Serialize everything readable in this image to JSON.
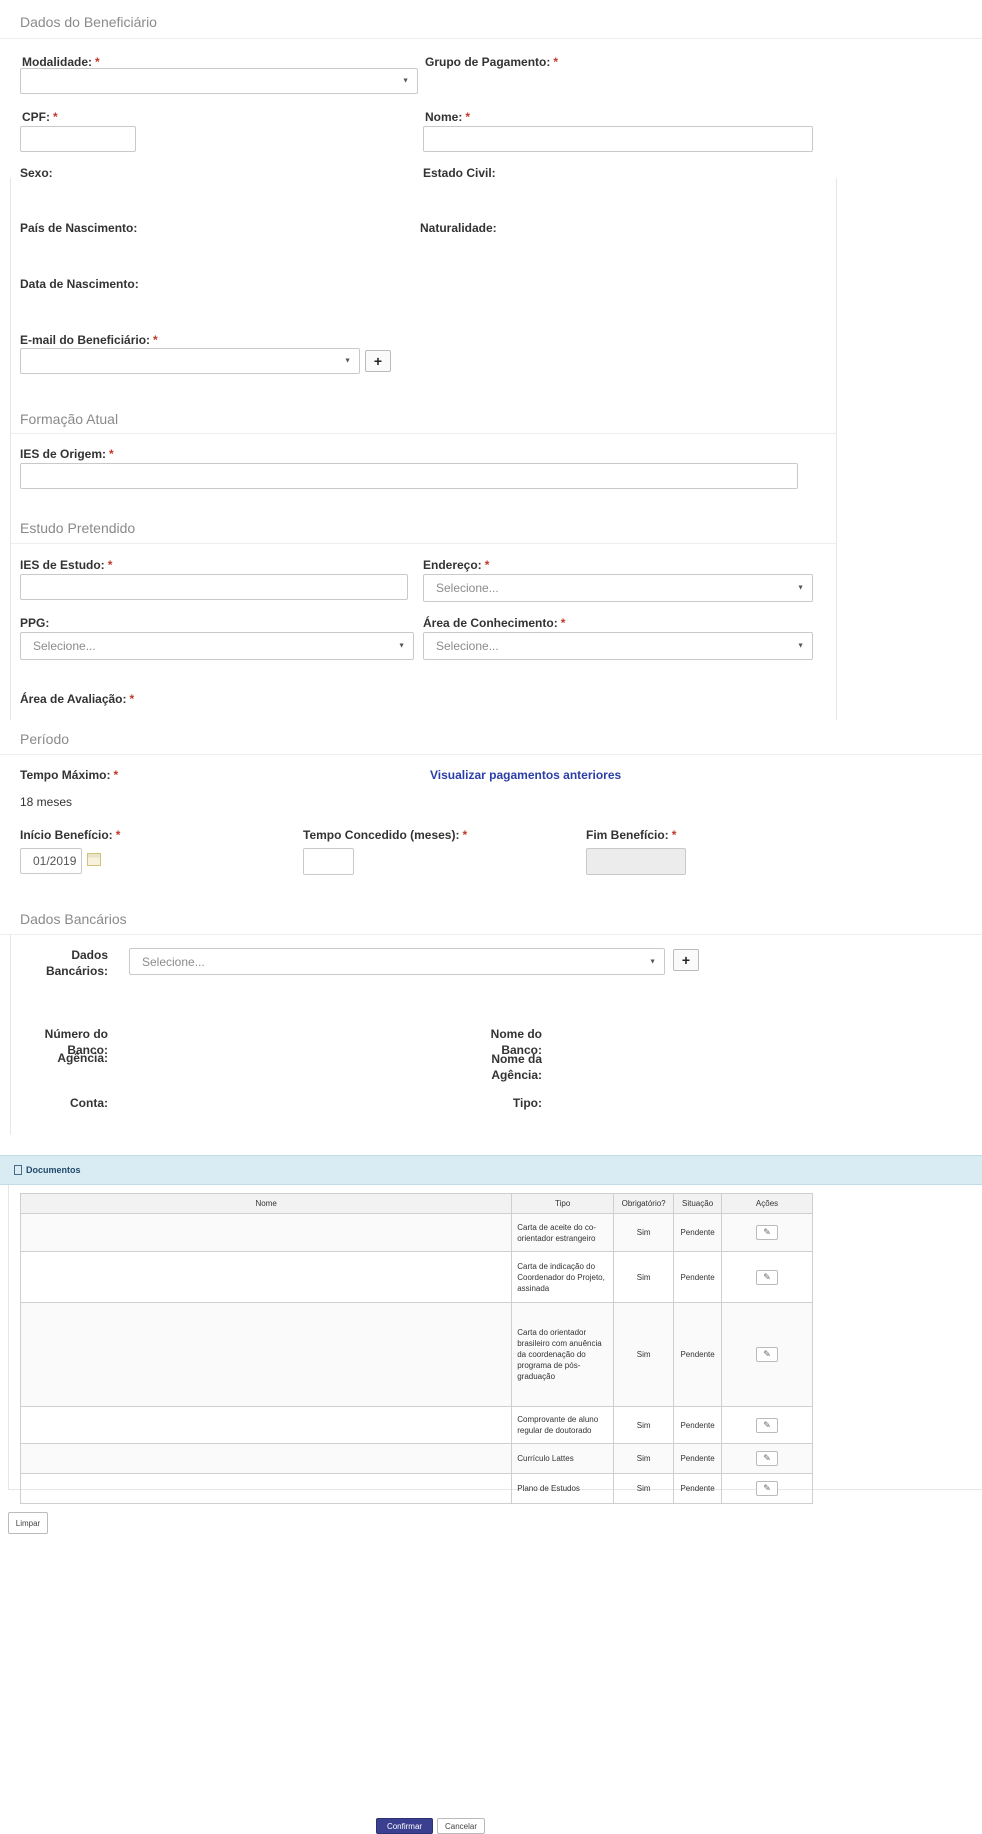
{
  "beneficiario": {
    "title": "Dados do Beneficiário",
    "modalidade_label": "Modalidade:",
    "grupo_label": "Grupo de Pagamento:",
    "cpf_label": "CPF:",
    "nome_label": "Nome:",
    "sexo_label": "Sexo:",
    "estado_civil_label": "Estado Civil:",
    "pais_label": "País de Nascimento:",
    "naturalidade_label": "Naturalidade:",
    "data_nasc_label": "Data de Nascimento:",
    "email_label": "E-mail do Beneficiário:",
    "required_mark": "*",
    "plus_label": "+"
  },
  "formacao": {
    "title": "Formação Atual",
    "ies_origem_label": "IES de Origem:"
  },
  "estudo": {
    "title": "Estudo Pretendido",
    "ies_estudo_label": "IES de Estudo:",
    "endereco_label": "Endereço:",
    "endereco_value": "Selecione...",
    "ppg_label": "PPG:",
    "ppg_value": "Selecione...",
    "area_conhecimento_label": "Área de Conhecimento:",
    "area_conhecimento_value": "Selecione...",
    "area_avaliacao_label": "Área de Avaliação:"
  },
  "periodo": {
    "title": "Período",
    "tempo_maximo_label": "Tempo Máximo:",
    "tempo_maximo_value": "18 meses",
    "visualizar_link": "Visualizar pagamentos anteriores",
    "inicio_label": "Início Benefício:",
    "inicio_value": "01/2019",
    "tempo_concedido_label": "Tempo Concedido (meses):",
    "fim_label": "Fim Benefício:"
  },
  "bancarios": {
    "title": "Dados Bancários",
    "dados_label_1": "Dados",
    "dados_label_2": "Bancários:",
    "dados_value": "Selecione...",
    "numero_banco_1": "Número do",
    "numero_banco_2": "Banco:",
    "nome_banco_1": "Nome do",
    "nome_banco_2": "Banco:",
    "agencia_label": "Agência:",
    "nome_agencia_1": "Nome da",
    "nome_agencia_2": "Agência:",
    "conta_label": "Conta:",
    "tipo_label": "Tipo:"
  },
  "documentos": {
    "title": "Documentos",
    "columns": [
      "Nome",
      "Tipo",
      "Obrigatório?",
      "Situação",
      "Ações"
    ],
    "rows": [
      {
        "tipo": "Carta de aceite do co-orientador estrangeiro",
        "obrigatorio": "Sim",
        "situacao": "Pendente"
      },
      {
        "tipo": "Carta de indicação do Coordenador do Projeto, assinada",
        "obrigatorio": "Sim",
        "situacao": "Pendente"
      },
      {
        "tipo": "Carta do orientador brasileiro com anuência da coordenação do programa de pós-graduação",
        "obrigatorio": "Sim",
        "situacao": "Pendente"
      },
      {
        "tipo": "Comprovante de aluno regular de doutorado",
        "obrigatorio": "Sim",
        "situacao": "Pendente"
      },
      {
        "tipo": "Currículo Lattes",
        "obrigatorio": "Sim",
        "situacao": "Pendente"
      },
      {
        "tipo": "Plano de Estudos",
        "obrigatorio": "Sim",
        "situacao": "Pendente"
      }
    ]
  },
  "actions": {
    "limpar": "Limpar",
    "confirmar": "Confirmar",
    "cancelar": "Cancelar"
  },
  "colors": {
    "primary_button": "#3a3f8f",
    "link": "#2c3ea8",
    "required": "#c0392b",
    "doc_header_bg": "#d9ecf4",
    "doc_type_text": "#8b1e24"
  }
}
